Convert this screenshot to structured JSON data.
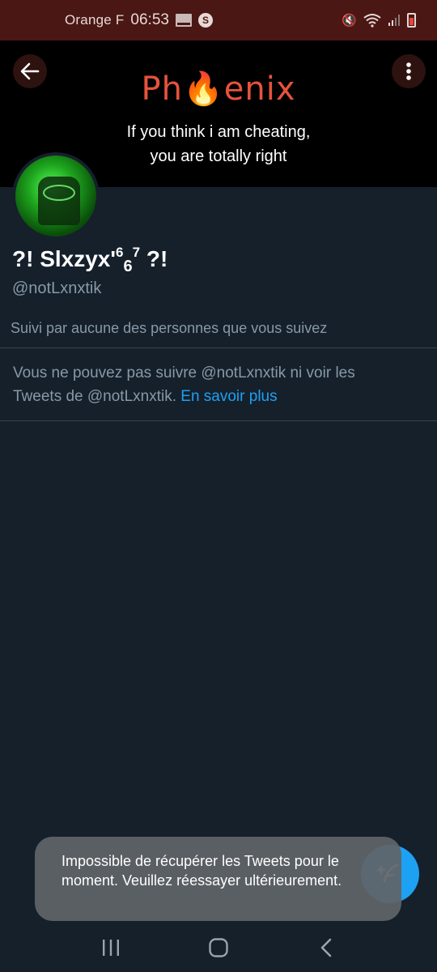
{
  "status_bar": {
    "carrier": "Orange F",
    "time": "06:53",
    "shazam_glyph": "S",
    "icons": [
      "notification-icon",
      "shazam-icon",
      "mute-icon",
      "wifi-icon",
      "signal-icon",
      "battery-icon"
    ],
    "mute_glyph": "🔇",
    "signal_glyph": "📶"
  },
  "banner": {
    "brand_prefix": "Ph",
    "brand_suffix": "enix",
    "tagline_line1": "If you think i am cheating,",
    "tagline_line2": "you are totally right",
    "brand_color": "#e6533c"
  },
  "profile": {
    "name_prefix": "?! Slxzyx'",
    "name_sup1": "6",
    "name_sub": "6",
    "name_sup2": "7",
    "name_suffix": " ?!",
    "handle": "@notLxnxtik",
    "followed_by": "Suivi par aucune des personnes que vous suivez"
  },
  "notice": {
    "text": "Vous ne pouvez pas suivre @notLxnxtik ni voir les Tweets de @notLxnxtik. ",
    "link": "En savoir plus",
    "link_color": "#1da1f2"
  },
  "toast": {
    "message": "Impossible de récupérer les Tweets pour le moment. Veuillez réessayer ultérieurement."
  },
  "colors": {
    "background": "#15202b",
    "status_bar": "#4a1714",
    "accent": "#1da1f2",
    "secondary_text": "#8899a6"
  }
}
